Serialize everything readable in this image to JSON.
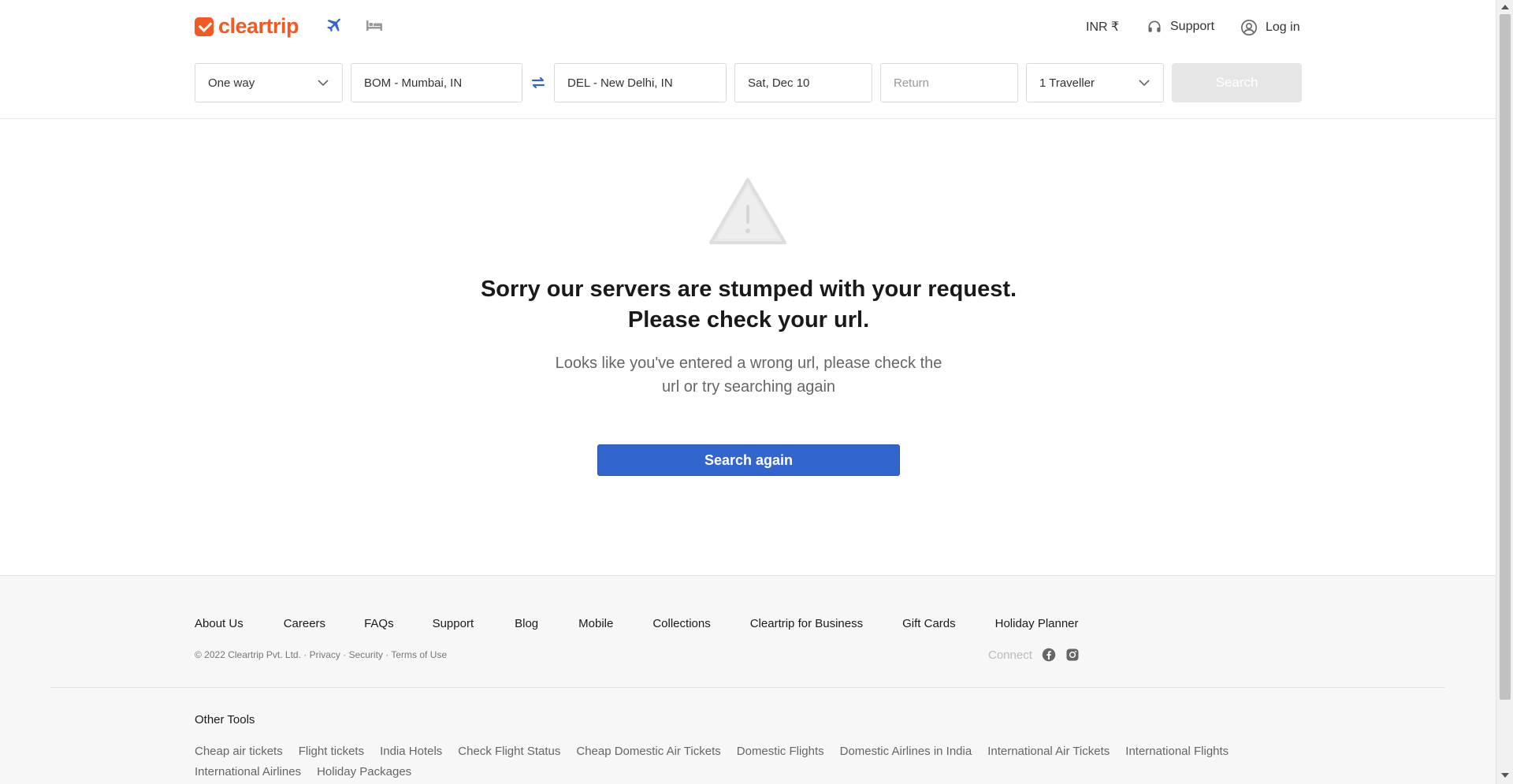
{
  "brand": {
    "name": "cleartrip",
    "color": "#f15a22"
  },
  "nav": {
    "flights_icon": "airplane-icon",
    "hotels_icon": "bed-icon"
  },
  "header": {
    "currency": "INR ₹",
    "support": "Support",
    "login": "Log in"
  },
  "search": {
    "trip_type": "One way",
    "from": "BOM - Mumbai, IN",
    "to": "DEL - New Delhi, IN",
    "depart": "Sat, Dec 10",
    "return_placeholder": "Return",
    "travellers": "1 Traveller",
    "button": "Search"
  },
  "error": {
    "title": "Sorry our servers are stumped with your request. Please check your url.",
    "subtitle": "Looks like you've entered a wrong url, please check the url or try searching again",
    "button": "Search again",
    "accent": "#3366cc"
  },
  "footer": {
    "links": [
      "About Us",
      "Careers",
      "FAQs",
      "Support",
      "Blog",
      "Mobile",
      "Collections",
      "Cleartrip for Business",
      "Gift Cards",
      "Holiday Planner"
    ],
    "copyright": "© 2022 Cleartrip Pvt. Ltd. · Privacy · Security · Terms of Use",
    "connect": "Connect",
    "other_tools_title": "Other Tools",
    "other_tools": [
      "Cheap air tickets",
      "Flight tickets",
      "India Hotels",
      "Check Flight Status",
      "Cheap Domestic Air Tickets",
      "Domestic Flights",
      "Domestic Airlines in India",
      "International Air Tickets",
      "International Flights",
      "International Airlines",
      "Holiday Packages"
    ]
  }
}
